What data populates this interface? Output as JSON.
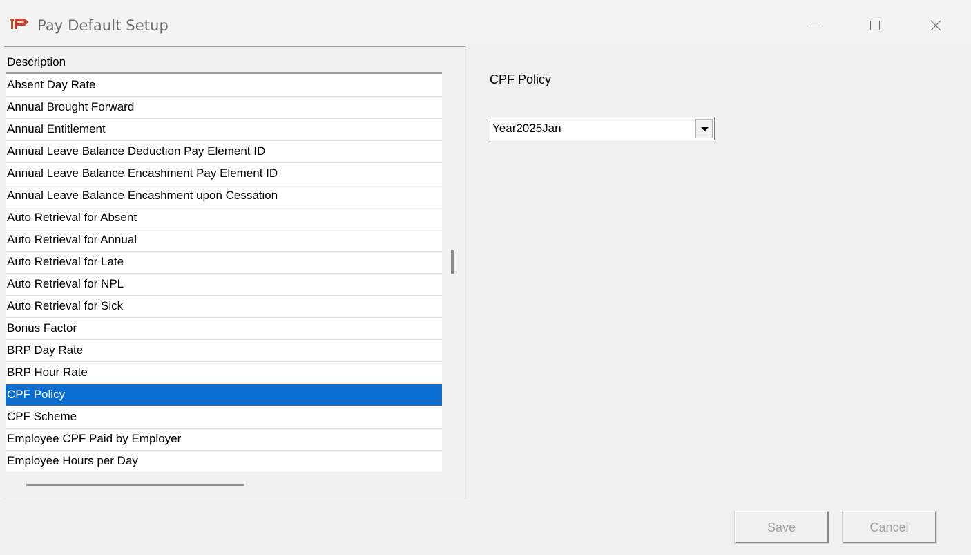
{
  "window": {
    "title": "Pay Default Setup",
    "icon": "app-logo-icon",
    "controls": [
      "minimize-icon",
      "maximize-icon",
      "close-icon"
    ]
  },
  "list": {
    "header": "Description",
    "items": [
      "Absent Day Rate",
      "Annual Brought Forward",
      "Annual Entitlement",
      "Annual Leave Balance Deduction Pay Element ID",
      "Annual Leave Balance Encashment Pay Element ID",
      "Annual Leave Balance Encashment upon Cessation",
      "Auto Retrieval for Absent",
      "Auto Retrieval for Annual",
      "Auto Retrieval for Late",
      "Auto Retrieval for NPL",
      "Auto Retrieval for Sick",
      "Bonus Factor",
      "BRP Day Rate",
      "BRP Hour Rate",
      "CPF Policy",
      "CPF Scheme",
      "Employee CPF Paid by Employer",
      "Employee Hours per Day"
    ],
    "selected_index": 14,
    "selection_color": "#0a6fd1"
  },
  "detail": {
    "label": "CPF Policy",
    "select_value": "Year2025Jan"
  },
  "buttons": {
    "save": "Save",
    "cancel": "Cancel"
  }
}
